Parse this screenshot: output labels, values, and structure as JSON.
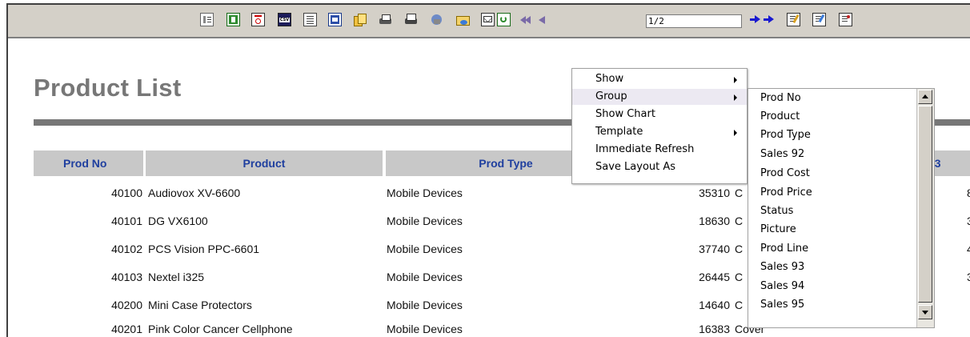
{
  "toolbar": {
    "icons": [
      "toggle-sidebar-icon",
      "export-excel-icon",
      "export-pdf-icon",
      "export-csv-icon",
      "export-text-icon",
      "export-word-icon",
      "export-multi-icon",
      "print-icon",
      "print-setup-icon",
      "schedule-icon",
      "open-folder-icon",
      "email-icon",
      "refresh-icon",
      "first-page-icon",
      "previous-page-icon",
      "next-page-icon",
      "last-page-icon",
      "edit-report-icon",
      "edit-layout-icon",
      "edit-query-icon"
    ],
    "page_value": "1/2"
  },
  "report": {
    "title": "Product List",
    "columns": [
      "Prod No",
      "Product",
      "Prod Type",
      "93"
    ],
    "rows": [
      {
        "prod_no": "40100",
        "product": "Audiovox XV-6600",
        "prod_type": "Mobile Devices",
        "value": "35310",
        "next": "C",
        "edge": "8"
      },
      {
        "prod_no": "40101",
        "product": "DG VX6100",
        "prod_type": "Mobile Devices",
        "value": "18630",
        "next": "C",
        "edge": "3"
      },
      {
        "prod_no": "40102",
        "product": "PCS Vision PPC-6601",
        "prod_type": "Mobile Devices",
        "value": "37740",
        "next": "C",
        "edge": "4"
      },
      {
        "prod_no": "40103",
        "product": "Nextel i325",
        "prod_type": "Mobile Devices",
        "value": "26445",
        "next": "C",
        "edge": "3"
      },
      {
        "prod_no": "40200",
        "product": "Mini Case Protectors",
        "prod_type": "Mobile Devices",
        "value": "14640",
        "next": "C",
        "edge": ""
      },
      {
        "prod_no": "40201",
        "product": "Pink Color Cancer Cellphone",
        "prod_type": "Mobile Devices",
        "value": "16383",
        "next": "Cover",
        "edge": ""
      }
    ]
  },
  "context_menu": {
    "items": [
      {
        "label": "Show",
        "submenu": true
      },
      {
        "label": "Group",
        "submenu": true,
        "active": true
      },
      {
        "label": "Show Chart",
        "submenu": false
      },
      {
        "label": "Template",
        "submenu": true
      },
      {
        "label": "Immediate Refresh",
        "submenu": false
      },
      {
        "label": "Save Layout As",
        "submenu": false
      }
    ]
  },
  "group_submenu": {
    "items": [
      "Prod No",
      "Product",
      "Prod Type",
      "Sales 92",
      "Prod Cost",
      "Prod Price",
      "Status",
      "Picture",
      "Prod Line",
      "Sales 93",
      "Sales 94",
      "Sales 95"
    ]
  }
}
